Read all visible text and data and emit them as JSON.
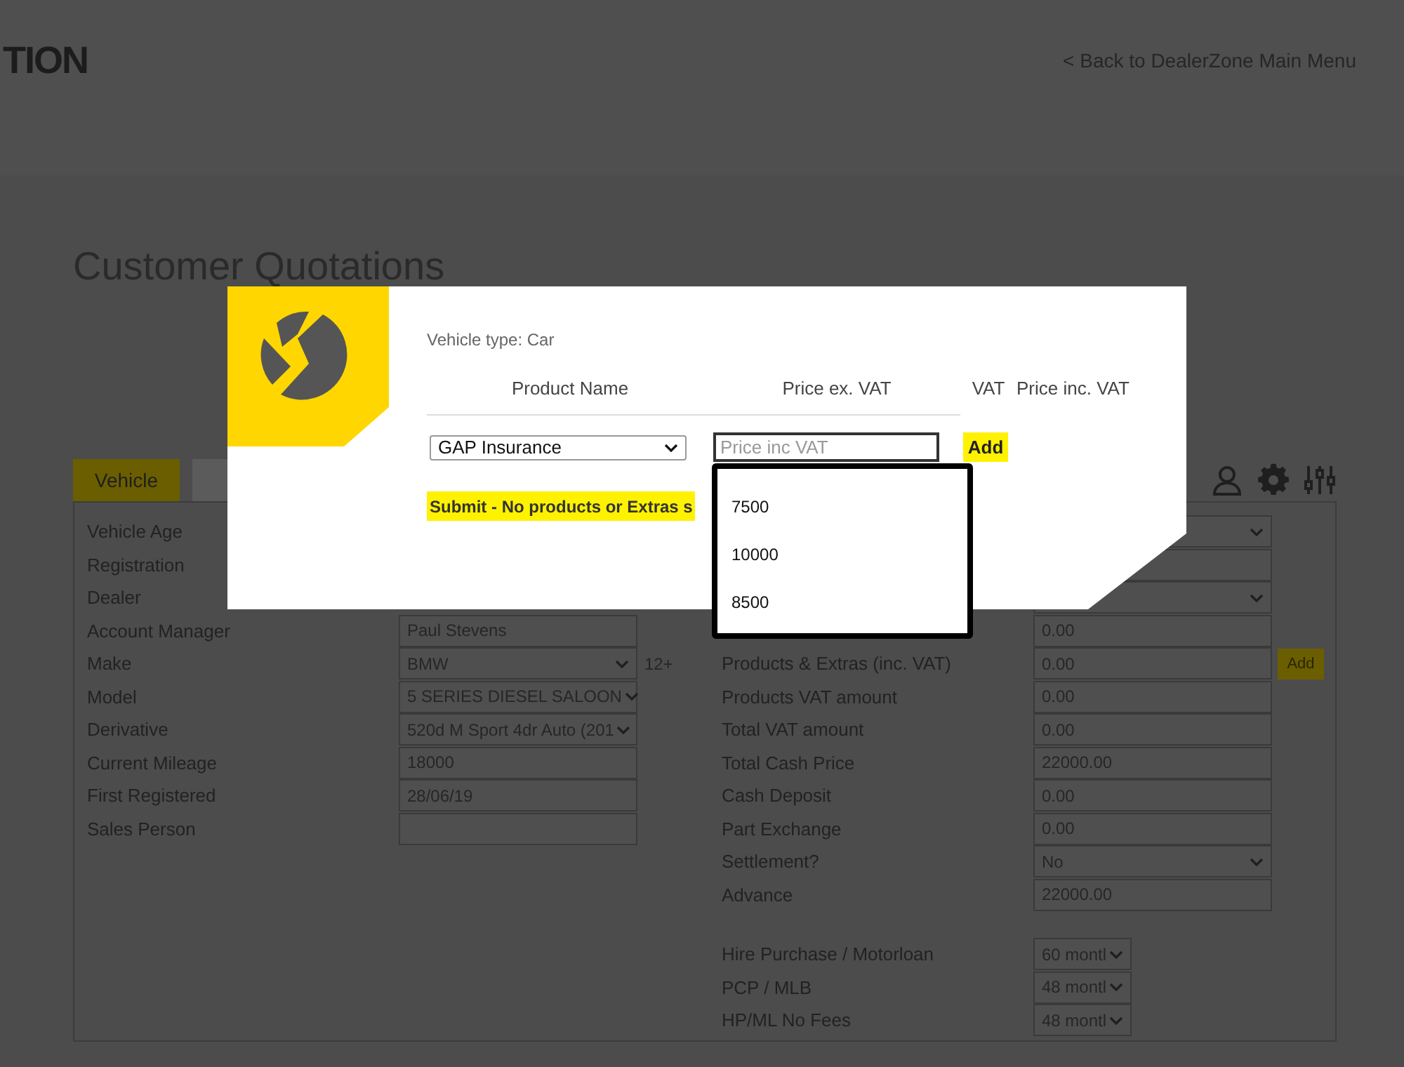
{
  "header": {
    "logo_text": "TION",
    "back_link": "< Back to DealerZone Main Menu"
  },
  "page_title": "Customer Quotations",
  "tabs": [
    {
      "label": "Vehicle",
      "selected": true
    },
    {
      "selected": false
    }
  ],
  "left_fields": [
    {
      "label": "Vehicle Age",
      "kind": "label"
    },
    {
      "label": "Registration",
      "kind": "label"
    },
    {
      "label": "Dealer",
      "kind": "label"
    },
    {
      "label": "Account Manager",
      "kind": "input",
      "value": "Paul Stevens"
    },
    {
      "label": "Make",
      "kind": "select",
      "value": "BMW",
      "suffix": "12+"
    },
    {
      "label": "Model",
      "kind": "select",
      "value": "5 SERIES DIESEL SALOON"
    },
    {
      "label": "Derivative",
      "kind": "select",
      "value": "520d M Sport 4dr Auto (201"
    },
    {
      "label": "Current Mileage",
      "kind": "input",
      "value": "18000"
    },
    {
      "label": "First Registered",
      "kind": "input",
      "value": "28/06/19"
    },
    {
      "label": "Sales Person",
      "kind": "input"
    }
  ],
  "right_fields": [
    {
      "kind": "select"
    },
    {
      "kind": "input"
    },
    {
      "kind": "select"
    },
    {
      "kind": "input",
      "value": "0.00"
    },
    {
      "label": "Products & Extras (inc. VAT)",
      "kind": "input",
      "value": "0.00",
      "button": "Add"
    },
    {
      "label": "Products VAT amount",
      "kind": "input",
      "value": "0.00"
    },
    {
      "label": "Total VAT amount",
      "kind": "input",
      "value": "0.00"
    },
    {
      "label": "Total Cash Price",
      "kind": "input",
      "value": "22000.00"
    },
    {
      "label": "Cash Deposit",
      "kind": "input",
      "value": "0.00"
    },
    {
      "label": "Part Exchange",
      "kind": "input",
      "value": "0.00"
    },
    {
      "label": "Settlement?",
      "kind": "select",
      "value": "No"
    },
    {
      "label": "Advance",
      "kind": "input",
      "value": "22000.00"
    }
  ],
  "term_fields": [
    {
      "label": "Hire Purchase / Motorloan",
      "kind": "select",
      "value": "60 montl"
    },
    {
      "label": "PCP / MLB",
      "kind": "select",
      "value": "48 montl"
    },
    {
      "label": "HP/ML No Fees",
      "kind": "select",
      "value": "48 montl"
    }
  ],
  "modal": {
    "vehicle_type": "Vehicle type: Car",
    "columns": [
      "Product Name",
      "Price ex. VAT",
      "VAT",
      "Price inc. VAT"
    ],
    "product_select": "GAP Insurance",
    "price_placeholder": "Price inc VAT",
    "add_button": "Add",
    "submit_button": "Submit - No products or Extras s",
    "suggestions": [
      "7500",
      "10000",
      "8500"
    ]
  }
}
